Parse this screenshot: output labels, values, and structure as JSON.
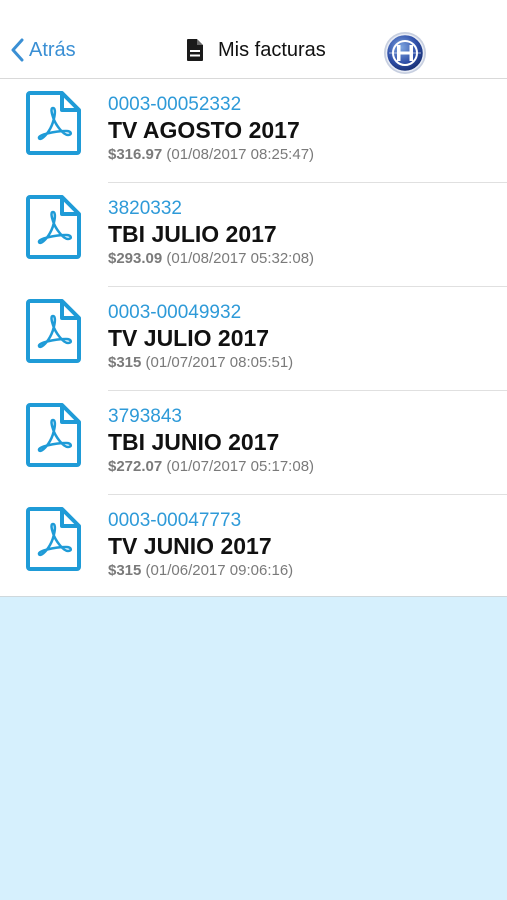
{
  "header": {
    "back_label": "Atrás",
    "title": "Mis facturas",
    "title_icon": "document-icon",
    "logo_icon": "brand-logo-icon"
  },
  "colors": {
    "accent": "#3a8fd4",
    "link": "#2e9ad8",
    "background": "#d6f0fd"
  },
  "invoices": [
    {
      "number": "0003-00052332",
      "title": "TV AGOSTO 2017",
      "amount": "$316.97",
      "date": "(01/08/2017 08:25:47)",
      "icon": "pdf-icon"
    },
    {
      "number": "3820332",
      "title": "TBI JULIO 2017",
      "amount": "$293.09",
      "date": "(01/08/2017 05:32:08)",
      "icon": "pdf-icon"
    },
    {
      "number": "0003-00049932",
      "title": "TV JULIO 2017",
      "amount": "$315",
      "date": "(01/07/2017 08:05:51)",
      "icon": "pdf-icon"
    },
    {
      "number": "3793843",
      "title": "TBI JUNIO 2017",
      "amount": "$272.07",
      "date": "(01/07/2017 05:17:08)",
      "icon": "pdf-icon"
    },
    {
      "number": "0003-00047773",
      "title": "TV JUNIO 2017",
      "amount": "$315",
      "date": "(01/06/2017 09:06:16)",
      "icon": "pdf-icon"
    }
  ]
}
